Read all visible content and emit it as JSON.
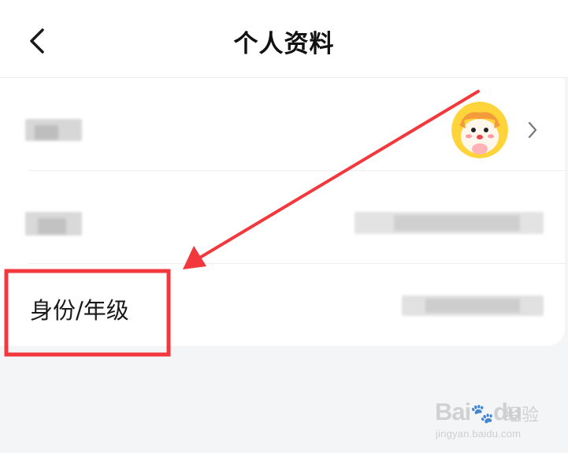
{
  "header": {
    "title": "个人资料",
    "back_icon": "chevron-left-icon"
  },
  "profile_rows": [
    {
      "label_blurred": true,
      "value_type": "avatar",
      "chevron_icon": "chevron-right-icon"
    },
    {
      "label_blurred": true,
      "value_blurred": true
    },
    {
      "label": "身份/年级",
      "value_blurred": true
    }
  ],
  "annotation": {
    "highlight_color": "#f2383c",
    "arrow_color": "#f2383c"
  },
  "watermark": {
    "brand": "Bai",
    "brand_suffix": "du",
    "cn_text": "经验",
    "url": "jingyan.baidu.com"
  },
  "colors": {
    "background": "#f4f5f7",
    "card": "#ffffff",
    "avatar_ring": "#ffd43b"
  }
}
